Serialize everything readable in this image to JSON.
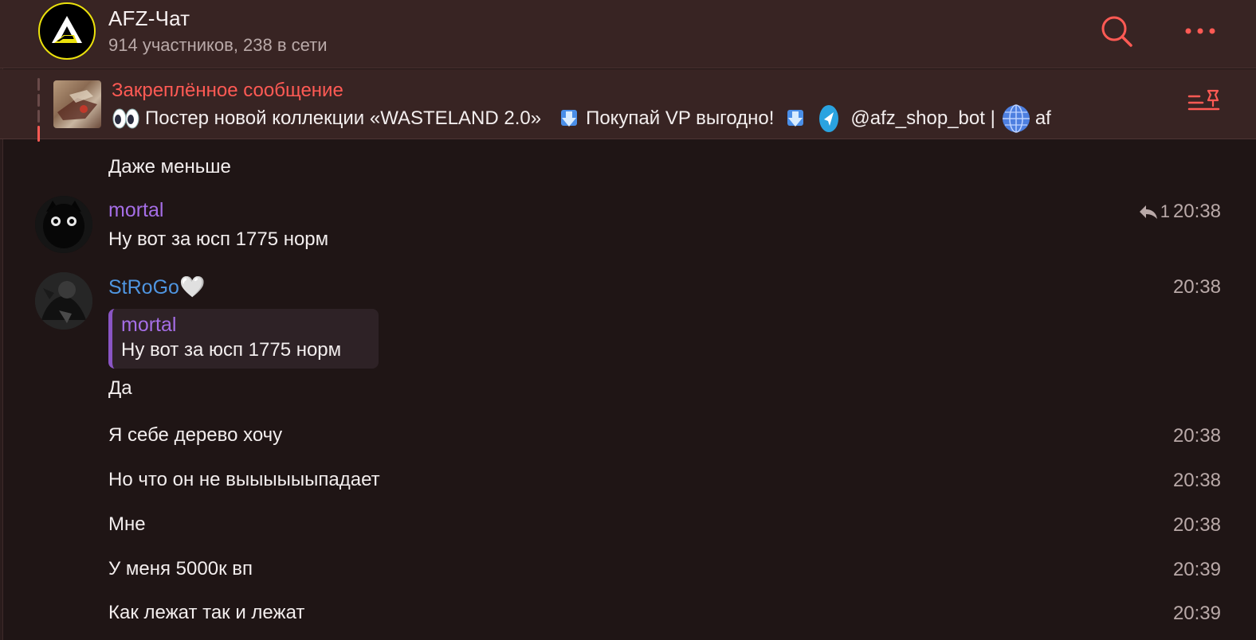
{
  "header": {
    "title": "AFZ-Чат",
    "subtitle": "914 участников, 238 в сети",
    "accent": "#ff5a54"
  },
  "pinned": {
    "label": "Закреплённое сообщение",
    "text_part1": "Постер новой коллекции «WASTELAND 2.0»",
    "text_part2": "Покупай VP выгодно!",
    "text_part3": "@afz_shop_bot |",
    "text_part4": "af"
  },
  "messages": [
    {
      "text": "Даже меньше"
    },
    {
      "sender": "mortal",
      "sender_color": "#a56ee6",
      "text": "Ну вот за юсп 1775 норм",
      "replies": "1",
      "time": "20:38"
    },
    {
      "sender": "StRoGo",
      "sender_suffix": "🤍",
      "sender_color": "#4f95e0",
      "reply_to_name": "mortal",
      "reply_to_text": "Ну вот за юсп 1775 норм",
      "text": "Да",
      "time": "20:38"
    },
    {
      "text": "Я себе дерево хочу",
      "time": "20:38"
    },
    {
      "text": "Но что он не выыыыыыпадает",
      "time": "20:38"
    },
    {
      "text": "Мне",
      "time": "20:38"
    },
    {
      "text": "У меня 5000к вп",
      "time": "20:39"
    },
    {
      "text": "Как лежат так и лежат",
      "time": "20:39"
    }
  ]
}
